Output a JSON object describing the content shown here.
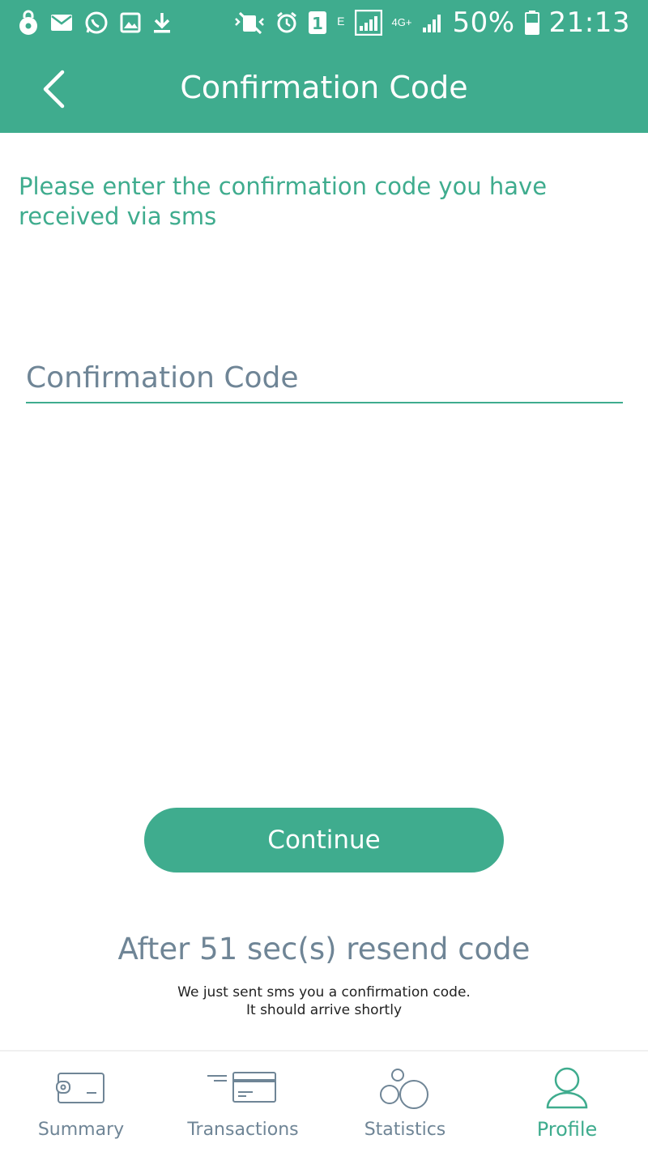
{
  "status_bar": {
    "battery": "50%",
    "time": "21:13",
    "sim_slot": "1",
    "network_e": "E",
    "network_4g": "4G+"
  },
  "header": {
    "title": "Confirmation Code"
  },
  "main": {
    "instruction": "Please enter the confirmation code you have received via sms",
    "code_input": {
      "placeholder": "Confirmation Code",
      "value": ""
    },
    "continue_label": "Continue",
    "resend_text": "After 51 sec(s) resend code",
    "sms_note_line1": "We just sent sms you a confirmation code.",
    "sms_note_line2": "It should arrive shortly"
  },
  "bottom_nav": {
    "items": [
      {
        "label": "Summary",
        "icon": "wallet-icon"
      },
      {
        "label": "Transactions",
        "icon": "card-icon"
      },
      {
        "label": "Statistics",
        "icon": "bubbles-icon"
      },
      {
        "label": "Profile",
        "icon": "user-icon",
        "active": true
      }
    ]
  },
  "colors": {
    "accent": "#3fac8e",
    "muted": "#6f8596"
  }
}
